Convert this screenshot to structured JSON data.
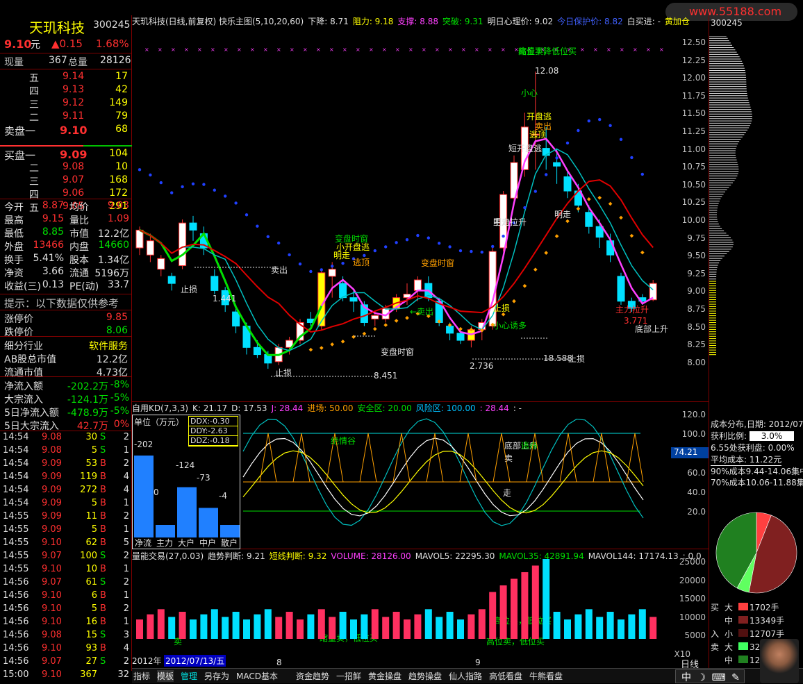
{
  "watermark": "www.55188.com",
  "stock": {
    "name": "天玑科技",
    "code": "300245",
    "price": "9.10",
    "unit": "元",
    "change": "▲0.15",
    "pct": "1.68%"
  },
  "quote": {
    "now_label": "现量",
    "now": "367",
    "total_label": "总量",
    "total": "28126"
  },
  "asks": [
    {
      "l": "五",
      "p": "9.14",
      "v": "17"
    },
    {
      "l": "四",
      "p": "9.13",
      "v": "42"
    },
    {
      "l": "三",
      "p": "9.12",
      "v": "149"
    },
    {
      "l": "二",
      "p": "9.11",
      "v": "79"
    },
    {
      "l": "卖盘一",
      "p": "9.10",
      "v": "68"
    }
  ],
  "bids": [
    {
      "l": "买盘一",
      "p": "9.09",
      "v": "104"
    },
    {
      "l": "二",
      "p": "9.08",
      "v": "10"
    },
    {
      "l": "三",
      "p": "9.07",
      "v": "168"
    },
    {
      "l": "四",
      "p": "9.06",
      "v": "172"
    },
    {
      "l": "五",
      "p": "9.05",
      "v": "291"
    }
  ],
  "stats": [
    {
      "a": "今开",
      "av": "8.87",
      "b": "均价",
      "bv": "9.03"
    },
    {
      "a": "最高",
      "av": "9.15",
      "b": "量比",
      "bv": "1.09"
    },
    {
      "a": "最低",
      "av": "8.85",
      "b": "市值",
      "bv": "12.2亿"
    },
    {
      "a": "外盘",
      "av": "13466",
      "b": "内盘",
      "bv": "14660"
    },
    {
      "a": "换手",
      "av": "5.41%",
      "b": "股本",
      "bv": "1.34亿"
    },
    {
      "a": "净资",
      "av": "3.66",
      "b": "流通",
      "bv": "5196万"
    },
    {
      "a": "收益(三)",
      "av": "0.13",
      "b": "PE(动)",
      "bv": "33.7"
    }
  ],
  "tip": "提示：以下数据仅供参考",
  "limits": [
    {
      "l": "涨停价",
      "v": "9.85"
    },
    {
      "l": "跌停价",
      "v": "8.06"
    }
  ],
  "info": [
    {
      "l": "细分行业",
      "v": "软件服务"
    },
    {
      "l": "AB股总市值",
      "v": "12.2亿"
    },
    {
      "l": "流通市值",
      "v": "4.73亿"
    }
  ],
  "flows": [
    {
      "l": "净流入额",
      "v": "-202.2万",
      "p": "-8%"
    },
    {
      "l": "大宗流入",
      "v": "-124.1万",
      "p": "-5%"
    },
    {
      "l": "5日净流入额",
      "v": "-478.9万",
      "p": "-5%"
    },
    {
      "l": "5日大宗流入",
      "v": "42.7万",
      "p": "0%"
    }
  ],
  "ticks": [
    [
      "14:54",
      "9.08",
      "30",
      "S",
      "2"
    ],
    [
      "14:54",
      "9.08",
      "5",
      "S",
      "1"
    ],
    [
      "14:54",
      "9.09",
      "53",
      "B",
      "2"
    ],
    [
      "14:54",
      "9.09",
      "119",
      "B",
      "4"
    ],
    [
      "14:54",
      "9.09",
      "272",
      "B",
      "4"
    ],
    [
      "14:54",
      "9.09",
      "5",
      "B",
      "1"
    ],
    [
      "14:55",
      "9.09",
      "11",
      "B",
      "2"
    ],
    [
      "14:55",
      "9.09",
      "5",
      "B",
      "1"
    ],
    [
      "14:55",
      "9.10",
      "62",
      "B",
      "5"
    ],
    [
      "14:55",
      "9.07",
      "100",
      "S",
      "2"
    ],
    [
      "14:55",
      "9.10",
      "10",
      "B",
      "1"
    ],
    [
      "14:56",
      "9.07",
      "61",
      "S",
      "2"
    ],
    [
      "14:56",
      "9.10",
      "6",
      "B",
      "1"
    ],
    [
      "14:56",
      "9.10",
      "5",
      "B",
      "2"
    ],
    [
      "14:56",
      "9.10",
      "16",
      "B",
      "1"
    ],
    [
      "14:56",
      "9.08",
      "15",
      "S",
      "3"
    ],
    [
      "14:56",
      "9.10",
      "93",
      "B",
      "4"
    ],
    [
      "14:56",
      "9.07",
      "27",
      "S",
      "2"
    ],
    [
      "15:00",
      "9.10",
      "367",
      "",
      "32"
    ]
  ],
  "main_title": [
    {
      "t": "天玑科技(日线,前复权) 快乐主图(5,10,20,60)",
      "c": "#e0e0e0"
    },
    {
      "t": "下降: 8.71",
      "c": "#e0e0e0"
    },
    {
      "t": "阻力: 9.18",
      "c": "#ffff00"
    },
    {
      "t": "支撑: 8.88",
      "c": "#ff40ff"
    },
    {
      "t": "突破: 9.31",
      "c": "#00e000"
    },
    {
      "t": "明日心理价: 9.02",
      "c": "#e0e0e0"
    },
    {
      "t": "今日保护价: 8.82",
      "c": "#4060ff"
    },
    {
      "t": "白买进: -",
      "c": "#e0e0e0"
    },
    {
      "t": "黄加仓",
      "c": "#ffff00"
    }
  ],
  "price_axis": [
    "12.50",
    "12.25",
    "12.00",
    "11.75",
    "11.50",
    "11.25",
    "11.00",
    "10.75",
    "10.50",
    "10.25",
    "10.00",
    "9.75",
    "9.50",
    "9.25",
    "9.00",
    "8.75",
    "8.50",
    "8.25",
    "8.00"
  ],
  "kd_axis": [
    "120.0",
    "100.0",
    "80.0",
    "60.0",
    "40.0",
    "20.0"
  ],
  "vol_axis": [
    "25000",
    "20000",
    "15000",
    "10000",
    "5000",
    "X10"
  ],
  "kd_title": [
    {
      "t": "自用KD(7,3,3)",
      "c": "#e0e0e0"
    },
    {
      "t": "K: 21.17",
      "c": "#e0e0e0"
    },
    {
      "t": "D: 17.53",
      "c": "#e0e0e0"
    },
    {
      "t": "J: 28.44",
      "c": "#ff40ff"
    },
    {
      "t": "进场: 50.00",
      "c": "#ffa000"
    },
    {
      "t": "安全区: 20.00",
      "c": "#00e000"
    },
    {
      "t": "风险区: 100.00",
      "c": "#00c0ff"
    },
    {
      "t": ": 28.44",
      "c": "#ff40ff"
    },
    {
      "t": ": -",
      "c": "#e0e0e0"
    }
  ],
  "vol_title": [
    {
      "t": "量能交易(27,0.03)",
      "c": "#e0e0e0"
    },
    {
      "t": "趋势判断: 9.21",
      "c": "#e0e0e0"
    },
    {
      "t": "短线判断: 9.32",
      "c": "#ffff00"
    },
    {
      "t": "VOLUME: 28126.00",
      "c": "#ff40ff"
    },
    {
      "t": "MAVOL5: 22295.30",
      "c": "#e0e0e0"
    },
    {
      "t": "MAVOL35: 42891.94",
      "c": "#00e000"
    },
    {
      "t": "MAVOL144: 17174.13",
      "c": "#e0e0e0"
    },
    {
      "t": ": 0.0",
      "c": "#e0e0e0"
    }
  ],
  "ddx": {
    "title": "单位（万元）",
    "lines": [
      "DDX:-0.30",
      "DDY:-2.63",
      "DDZ:-0.18"
    ],
    "bars": [
      {
        "l": "净流",
        "v": -202
      },
      {
        "l": "主力",
        "v": 0
      },
      {
        "l": "大户",
        "v": -124
      },
      {
        "l": "中户",
        "v": -73
      },
      {
        "l": "散户",
        "v": -4
      }
    ],
    "labels": [
      "-202",
      "0",
      "-124",
      "-73",
      "-4"
    ]
  },
  "kd_side": "74.21",
  "annotations": [
    "高位下降",
    "12.08",
    "小心",
    "开盘逃",
    "卖出",
    "逃顶",
    "短开盘逃",
    "明走",
    "变盘时窗",
    "小开盘逃",
    "明走",
    "逃顶",
    "卖出",
    "止损",
    "1.441",
    "变盘时窗",
    "←卖出",
    "主力拉升",
    "明走",
    "变盘时窗",
    "2.736",
    "18.588",
    "止损",
    "止损",
    "8.451",
    "止损",
    "小心诱多",
    "主力拉升",
    "底部上升",
    "3.771",
    "底部上升",
    "逃命",
    "卖",
    "走",
    "绝情谷",
    "卖",
    "缩量卖，低位买",
    "高位卖，低位买",
    "高位卖，低位买",
    "缩量卖，低位买"
  ],
  "x_labels": [
    "8",
    "9"
  ],
  "dates": {
    "year": "2012年",
    "date": "2012/07/13/五"
  },
  "right": {
    "code": "300245",
    "cost_title": "成本分布,日期: 2012/07/",
    "profit_label": "获利比例:",
    "profit": "3.0%",
    "cost_line": "6.55处获利盘: 0.00%",
    "avg": "平均成本: 11.22元",
    "c90": "90%成本9.44-14.06集中",
    "c70": "70%成本10.06-11.88集中",
    "buy": "买",
    "sell": "卖",
    "in": "入",
    "big": "大",
    "mid": "中",
    "small": "小",
    "v1": "1702手",
    "v2": "13349手",
    "v3": "12707手",
    "v4": "326",
    "v5": "122",
    "day": "日线"
  },
  "pie": {
    "slices": [
      {
        "name": "大买",
        "value": 6,
        "color": "#ff4040"
      },
      {
        "name": "中买",
        "value": 47,
        "color": "#802020"
      },
      {
        "name": "大卖",
        "value": 5,
        "color": "#60ff60"
      },
      {
        "name": "中卖",
        "value": 42,
        "color": "#208020"
      }
    ]
  },
  "tabs": [
    "指标",
    "模板",
    "管理",
    "另存为",
    "MACD基本",
    "资金趋势",
    "一招鲜",
    "黄金操盘",
    "趋势操盘",
    "仙人指路",
    "高低看盘",
    "牛熊看盘"
  ],
  "status_bar": "中"
}
